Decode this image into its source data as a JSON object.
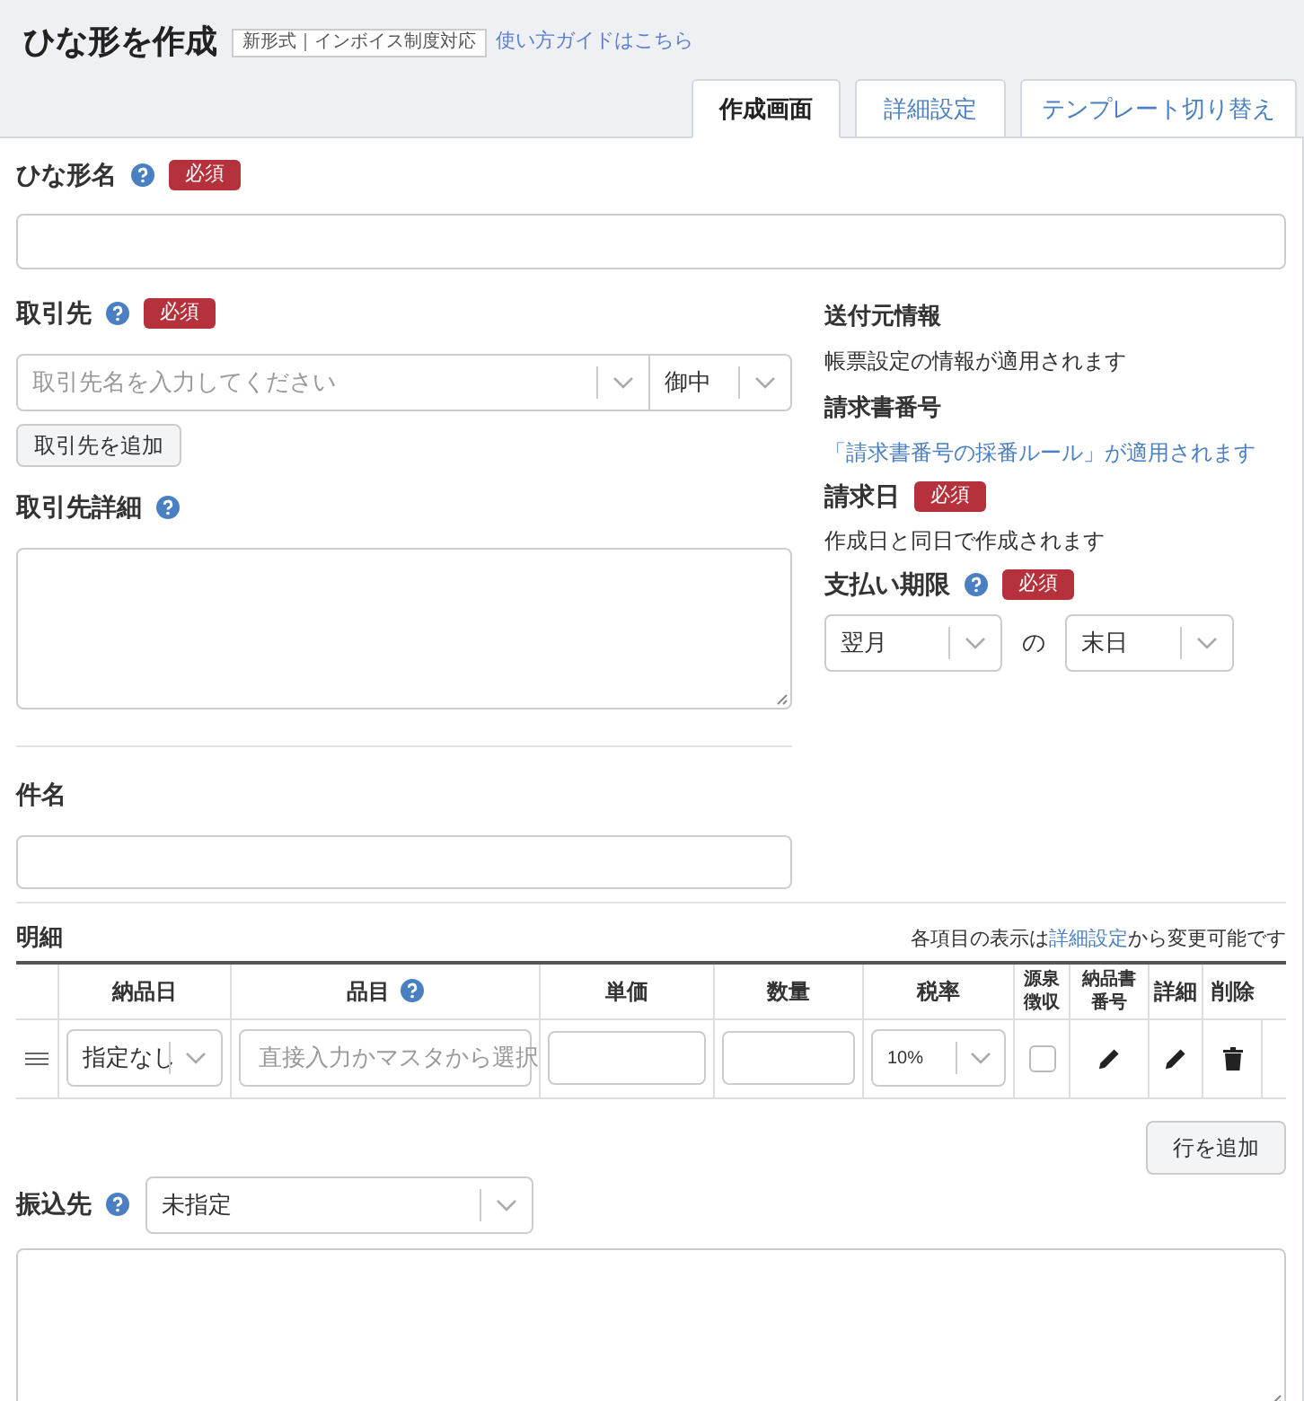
{
  "header": {
    "title": "ひな形を作成",
    "badge": "新形式｜インボイス制度対応",
    "guide_link": "使い方ガイドはこちら"
  },
  "tabs": [
    {
      "label": "作成画面",
      "selected": true
    },
    {
      "label": "詳細設定",
      "selected": false
    },
    {
      "label": "テンプレート切り替え",
      "selected": false
    }
  ],
  "template_name": {
    "label": "ひな形名",
    "help": true,
    "required": "必須"
  },
  "client": {
    "label": "取引先",
    "help": true,
    "required": "必須",
    "placeholder": "取引先名を入力してください",
    "honorific": "御中",
    "add_button": "取引先を追加"
  },
  "client_detail": {
    "label": "取引先詳細",
    "help": true
  },
  "sender": {
    "heading": "送付元情報",
    "text": "帳票設定の情報が適用されます"
  },
  "invoice_number": {
    "heading": "請求書番号",
    "text": "「請求書番号の採番ルール」が適用されます"
  },
  "invoice_date": {
    "label": "請求日",
    "required": "必須",
    "text": "作成日と同日で作成されます"
  },
  "payment_due": {
    "label": "支払い期限",
    "help": true,
    "required": "必須",
    "month": "翌月",
    "separator": "の",
    "day": "末日"
  },
  "subject": {
    "label": "件名"
  },
  "details": {
    "title": "明細",
    "note_before": "各項目の表示は",
    "note_link": "詳細設定",
    "note_after": "から変更可能です",
    "columns": [
      {
        "label": "納品日",
        "help": false
      },
      {
        "label": "品目",
        "help": true
      },
      {
        "label": "単価",
        "help": false
      },
      {
        "label": "数量",
        "help": false
      },
      {
        "label": "税率",
        "help": false
      },
      {
        "label": "源泉徴収",
        "help": false
      },
      {
        "label": "納品書番号",
        "help": false
      },
      {
        "label": "詳細",
        "help": false
      },
      {
        "label": "削除",
        "help": false
      }
    ],
    "row": {
      "delivery_date": "指定なし",
      "item_placeholder": "直接入力かマスタから選択",
      "tax_rate": "10%",
      "withholding": false
    },
    "add_row_button": "行を追加"
  },
  "bank": {
    "label": "振込先",
    "help": true,
    "value": "未指定"
  }
}
